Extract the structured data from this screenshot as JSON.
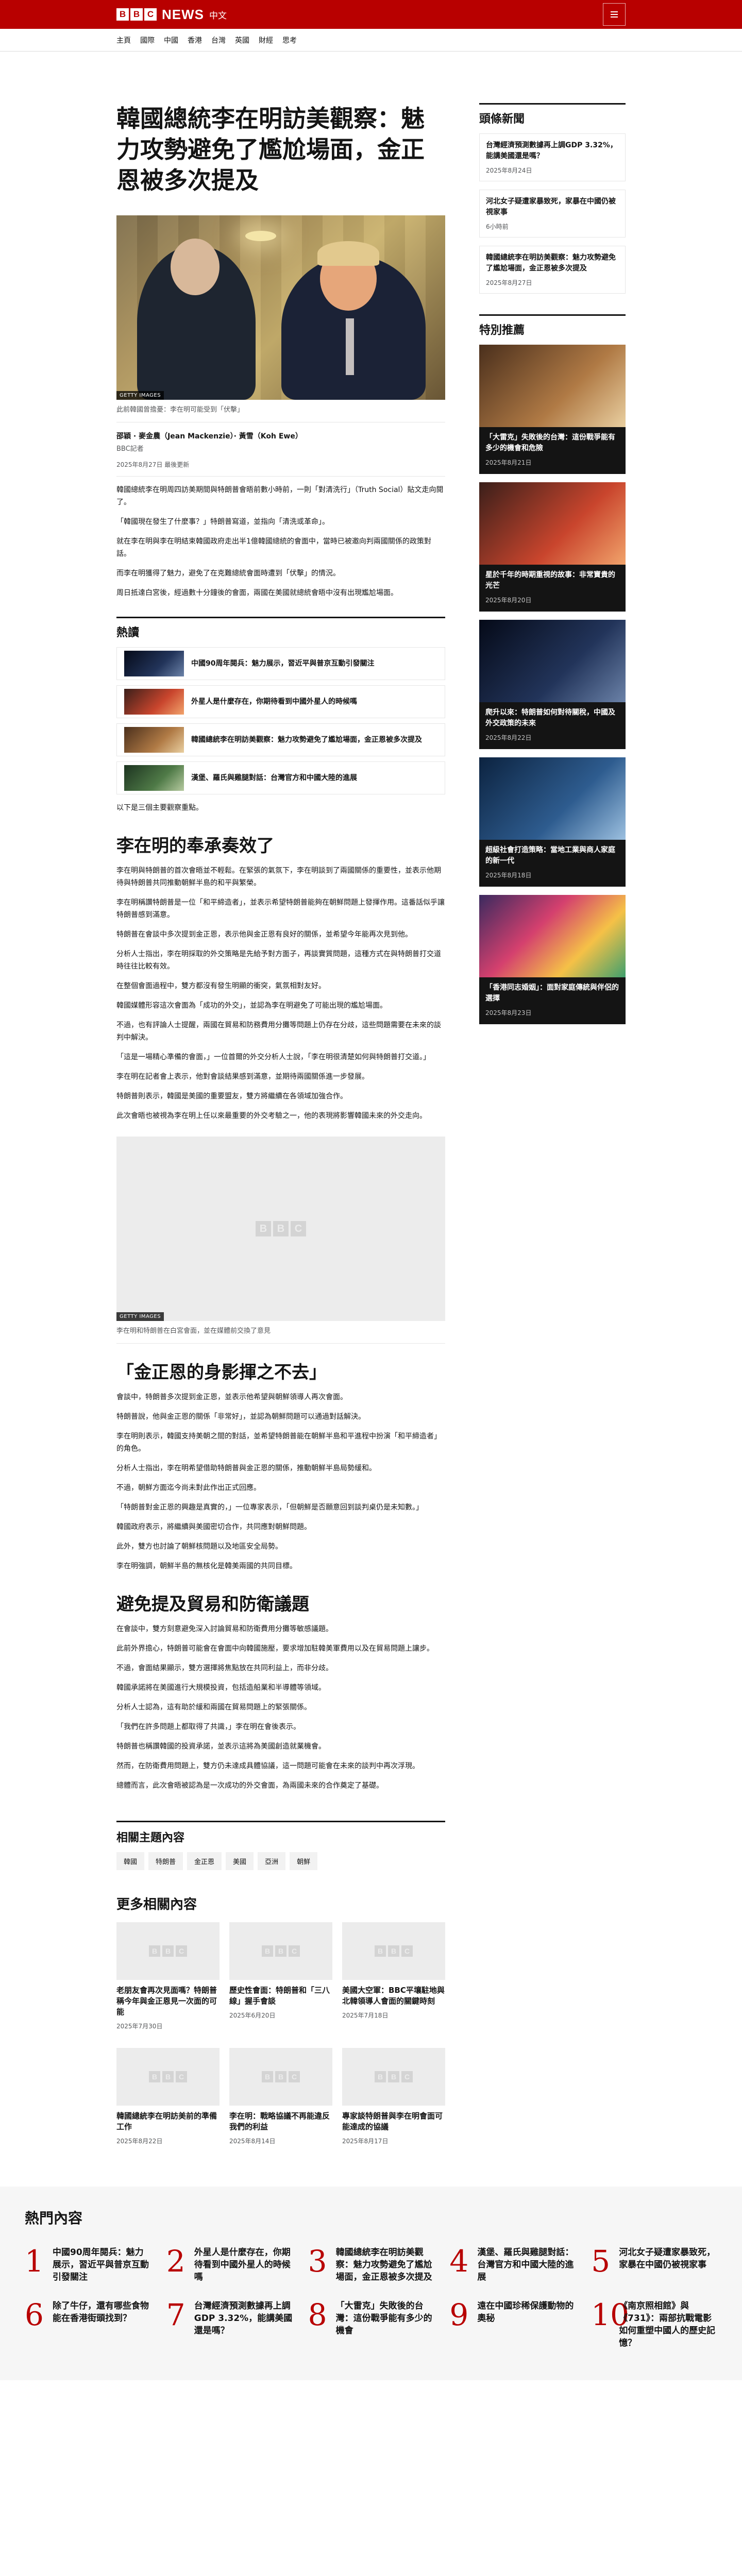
{
  "header": {
    "brand_letters": [
      "B",
      "B",
      "C"
    ],
    "brand_news": "NEWS",
    "brand_lang": "中文"
  },
  "nav": [
    "主頁",
    "國際",
    "中國",
    "香港",
    "台灣",
    "英國",
    "財經",
    "思考"
  ],
  "article": {
    "headline": "韓國總統李在明訪美觀察：魅力攻勢避免了尷尬場面，金正恩被多次提及",
    "hero_credit": "GETTY IMAGES",
    "hero_caption": "此前韓國曾擔憂：李在明可能受到「伏擊」",
    "byline_name": "邵穎 · 麥金農（Jean Mackenzie）· 黃雪（Koh Ewe）",
    "byline_role": "BBC記者",
    "date": "2025年8月27日 最後更新",
    "paragraphs_intro": [
      "韓國總統李在明周四訪美期間與特朗普會晤前數小時前，一則「對清洗行」（Truth Social）貼文走向閱了。",
      "「韓國現在發生了什麼事？」特朗普寫道，並指向「清洗或革命」。",
      "就在李在明與李在明結束韓國政府走出半1億韓國總統的會面中，當時已被邀向判兩國關係的政策對話。",
      "而李在明獲得了魅力，避免了在克難總統會面時遭到「伏擊」的情況。",
      "周日抵達白宮後，經過數十分鐘後的會面，兩國在美國就總統會晤中沒有出現尷尬場面。"
    ],
    "popular_title": "熱讀",
    "popular_items": [
      "中國90周年閱兵：魅力展示，習近平與普京互動引發關注",
      "外星人是什麼存在，你期待看到中國外星人的時候嗎",
      "韓國總統李在明訪美觀察：魅力攻勢避免了尷尬場面，金正恩被多次提及",
      "漢堡、羅氏與雞腿對話：台灣官方和中國大陸的進展"
    ],
    "after_popular": "以下是三個主要觀察重點。",
    "section1_title": "李在明的奉承奏效了",
    "section1_paragraphs": [
      "李在明與特朗普的首次會晤並不輕鬆。在緊張的氣氛下，李在明談到了兩國關係的重要性，並表示他期待與特朗普共同推動朝鮮半島的和平與繁榮。",
      "李在明稱讚特朗普是一位「和平締造者」，並表示希望特朗普能夠在朝鮮問題上發揮作用。這番話似乎讓特朗普感到滿意。",
      "特朗普在會談中多次提到金正恩，表示他與金正恩有良好的關係，並希望今年能再次見到他。",
      "分析人士指出，李在明採取的外交策略是先給予對方面子，再談實質問題，這種方式在與特朗普打交道時往往比較有效。",
      "在整個會面過程中，雙方都沒有發生明顯的衝突，氣氛相對友好。",
      "韓國媒體形容這次會面為「成功的外交」，並認為李在明避免了可能出現的尷尬場面。",
      "不過，也有評論人士提醒，兩國在貿易和防務費用分攤等問題上仍存在分歧，這些問題需要在未來的談判中解決。",
      "「這是一場精心準備的會面，」一位首爾的外交分析人士說，「李在明很清楚如何與特朗普打交道。」",
      "李在明在記者會上表示，他對會談結果感到滿意，並期待兩國關係進一步發展。",
      "特朗普則表示，韓國是美國的重要盟友，雙方將繼續在各領域加強合作。",
      "此次會晤也被視為李在明上任以來最重要的外交考驗之一，他的表現將影響韓國未來的外交走向。"
    ],
    "embed_credit": "GETTY IMAGES",
    "embed_caption": "李在明和特朗普在白宮會面，並在媒體前交換了意見",
    "quote": "「金正恩的身影揮之不去」",
    "section2_paragraphs": [
      "會談中，特朗普多次提到金正恩，並表示他希望與朝鮮領導人再次會面。",
      "特朗普說，他與金正恩的關係「非常好」，並認為朝鮮問題可以通過對話解決。",
      "李在明則表示，韓國支持美朝之間的對話，並希望特朗普能在朝鮮半島和平進程中扮演「和平締造者」的角色。",
      "分析人士指出，李在明希望借助特朗普與金正恩的關係，推動朝鮮半島局勢緩和。",
      "不過，朝鮮方面迄今尚未對此作出正式回應。",
      "「特朗普對金正恩的興趣是真實的，」一位專家表示，「但朝鮮是否願意回到談判桌仍是未知數。」",
      "韓國政府表示，將繼續與美國密切合作，共同應對朝鮮問題。",
      "此外，雙方也討論了朝鮮核問題以及地區安全局勢。",
      "李在明強調，朝鮮半島的無核化是韓美兩國的共同目標。"
    ],
    "section3_title": "避免提及貿易和防衛議題",
    "section3_paragraphs": [
      "在會談中，雙方刻意避免深入討論貿易和防衛費用分攤等敏感議題。",
      "此前外界擔心，特朗普可能會在會面中向韓國施壓，要求增加駐韓美軍費用以及在貿易問題上讓步。",
      "不過，會面結果顯示，雙方選擇將焦點放在共同利益上，而非分歧。",
      "韓國承諾將在美國進行大規模投資，包括造船業和半導體等領域。",
      "分析人士認為，這有助於緩和兩國在貿易問題上的緊張關係。",
      "「我們在許多問題上都取得了共識，」李在明在會後表示。",
      "特朗普也稱讚韓國的投資承諾，並表示這將為美國創造就業機會。",
      "然而，在防衛費用問題上，雙方仍未達成具體協議，這一問題可能會在未來的談判中再次浮現。",
      "總體而言，此次會晤被認為是一次成功的外交會面，為兩國未來的合作奠定了基礎。"
    ],
    "related_title": "相關主題內容",
    "related_tags": [
      "韓國",
      "特朗普",
      "金正恩",
      "美國",
      "亞洲",
      "朝鮮"
    ]
  },
  "more": {
    "title": "更多相關內容",
    "cards": [
      {
        "title": "老朋友會再次見面嗎？特朗普稱今年與金正恩見一次面的可能",
        "date": "2025年7月30日"
      },
      {
        "title": "歷史性會面：特朗普和「三八線」握手會談",
        "date": "2025年6月20日"
      },
      {
        "title": "美國大空軍：BBC平壤駐地與北韓領導人會面的關鍵時刻",
        "date": "2025年7月18日"
      },
      {
        "title": "韓國總統李在明訪美前的準備工作",
        "date": "2025年8月22日"
      },
      {
        "title": "李在明：戰略協議不再能違反我們的利益",
        "date": "2025年8月14日"
      },
      {
        "title": "專家談特朗普與李在明會面可能達成的協議",
        "date": "2025年8月17日"
      }
    ]
  },
  "sidebar": {
    "news_title": "頭條新聞",
    "news": [
      {
        "title": "台灣經濟預測數據再上調GDP 3.32%，能講美國還是嗎？",
        "date": "2025年8月24日"
      },
      {
        "title": "河北女子疑遭家暴致死，家暴在中國仍被視家事",
        "date": "6小時前"
      },
      {
        "title": "韓國總統李在明訪美觀察：魅力攻勢避免了尷尬場面，金正恩被多次提及",
        "date": "2025年8月27日"
      }
    ],
    "featured_title": "特別推薦",
    "featured": [
      {
        "title": "「大雷克」失敗後的台灣：這份戰爭能有多少的機會和危險",
        "date": "2025年8月21日"
      },
      {
        "title": "星於千年的時期重視的故事：非常寶貴的光芒",
        "date": "2025年8月20日"
      },
      {
        "title": "爬升以來：特朗普如何對待關稅，中國及外交政策的未來",
        "date": "2025年8月22日"
      },
      {
        "title": "超級社會打造策略：當地工業與商人家庭的新一代",
        "date": "2025年8月18日"
      },
      {
        "title": "「香港同志婚姻」：面對家庭傳統與伴侶的選擇",
        "date": "2025年8月23日"
      }
    ]
  },
  "mostread": {
    "title": "熱門內容",
    "items": [
      {
        "num": "1",
        "text": "中國90周年閱兵：魅力展示，習近平與普京互動引發關注"
      },
      {
        "num": "2",
        "text": "外星人是什麼存在，你期待看到中國外星人的時候嗎"
      },
      {
        "num": "3",
        "text": "韓國總統李在明訪美觀察：魅力攻勢避免了尷尬場面，金正恩被多次提及"
      },
      {
        "num": "4",
        "text": "漢堡、羅氏與雞腿對話：台灣官方和中國大陸的進展"
      },
      {
        "num": "5",
        "text": "河北女子疑遭家暴致死，家暴在中國仍被視家事"
      },
      {
        "num": "6",
        "text": "除了牛仔，還有哪些食物能在香港街頭找到？"
      },
      {
        "num": "7",
        "text": "台灣經濟預測數據再上調GDP 3.32%，能講美國還是嗎？"
      },
      {
        "num": "8",
        "text": "「大雷克」失敗後的台灣：這份戰爭能有多少的機會"
      },
      {
        "num": "9",
        "text": "遠在中國珍稀保護動物的奧秘"
      },
      {
        "num": "10",
        "text": "《南京照相館》與《731》：兩部抗戰電影如何重塑中國人的歷史記憶？"
      }
    ]
  }
}
